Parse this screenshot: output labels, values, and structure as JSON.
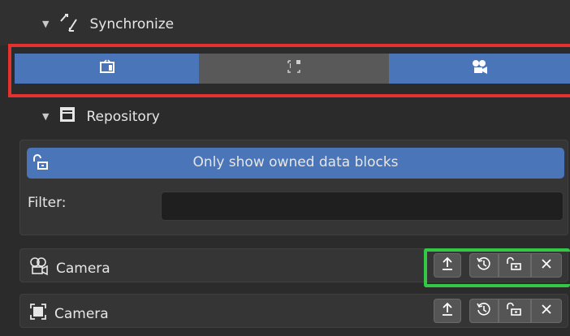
{
  "header": {
    "title": "Synchronize"
  },
  "tabs": [
    {
      "icon": "tv-icon",
      "state": "active"
    },
    {
      "icon": "select-box-icon",
      "state": "inactive"
    },
    {
      "icon": "camera-icon",
      "state": "active"
    }
  ],
  "repository": {
    "title": "Repository"
  },
  "toggle": {
    "label": "Only show owned data blocks",
    "icon": "unlock-icon"
  },
  "filter": {
    "label": "Filter:",
    "value": "",
    "placeholder": ""
  },
  "items": [
    {
      "label": "Camera",
      "icon": "camera-data-icon",
      "highlighted": true
    },
    {
      "label": "Camera",
      "icon": "object-frame-icon",
      "highlighted": false
    }
  ],
  "colors": {
    "accent": "#4a75b8",
    "red_highlight": "#e5322e",
    "green_highlight": "#33c944"
  }
}
